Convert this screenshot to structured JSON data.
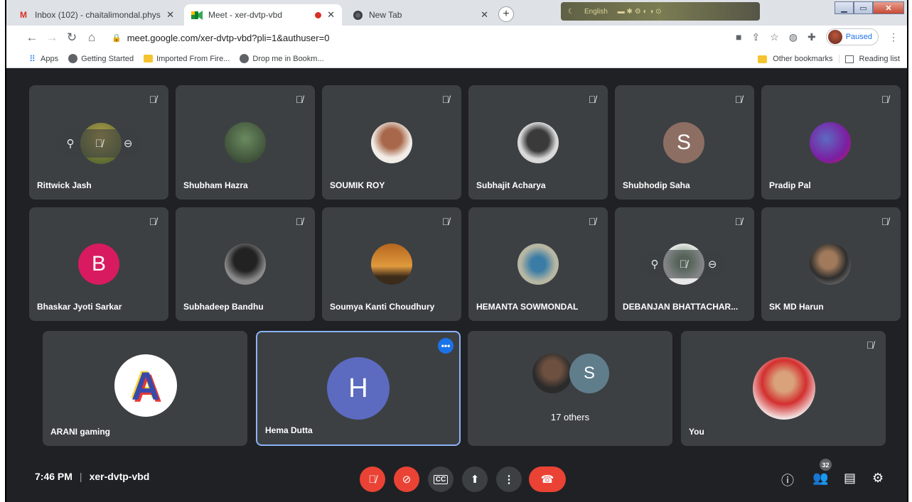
{
  "browser": {
    "tabs": [
      {
        "title": "Inbox (102) - chaitalimondal.phys",
        "favicon": "gmail-icon"
      },
      {
        "title": "Meet - xer-dvtp-vbd",
        "favicon": "meet-icon"
      },
      {
        "title": "New Tab",
        "favicon": "chrome-icon"
      }
    ],
    "taskbar_language": "English",
    "url": "meet.google.com/xer-dvtp-vbd?pli=1&authuser=0",
    "profile_status": "Paused",
    "bookmarks": [
      {
        "label": "Apps"
      },
      {
        "label": "Getting Started"
      },
      {
        "label": "Imported From Fire..."
      },
      {
        "label": "Drop me in Bookm..."
      }
    ],
    "other_bookmarks": "Other bookmarks",
    "reading_list": "Reading list"
  },
  "meet": {
    "time": "7:46 PM",
    "meeting_code": "xer-dvtp-vbd",
    "people_count": "32",
    "colors": {
      "accent_blue": "#1a73e8",
      "danger_red": "#ea4335",
      "tile_bg": "#3c4043",
      "stage_bg": "#202124"
    },
    "row1": [
      {
        "name": "Rittwick Jash",
        "avatar_color": "#6b7c3a",
        "initial": ""
      },
      {
        "name": "Shubham Hazra",
        "avatar_color": "#4f6b52",
        "initial": ""
      },
      {
        "name": "SOUMIK ROY",
        "avatar_color": "#c9b9a6",
        "initial": ""
      },
      {
        "name": "Subhajit Acharya",
        "avatar_color": "#d7d7d7",
        "initial": ""
      },
      {
        "name": "Shubhodip Saha",
        "avatar_color": "#8d6e63",
        "initial": "S"
      },
      {
        "name": "Pradip Pal",
        "avatar_color": "#7b1fa2",
        "initial": ""
      }
    ],
    "row2": [
      {
        "name": "Bhaskar Jyoti Sarkar",
        "avatar_color": "#d81b60",
        "initial": "B"
      },
      {
        "name": "Subhadeep Bandhu",
        "avatar_color": "#555555",
        "initial": ""
      },
      {
        "name": "Soumya Kanti Choudhury",
        "avatar_color": "#c17a2c",
        "initial": ""
      },
      {
        "name": "HEMANTA SOWMONDAL",
        "avatar_color": "#7a8a9a",
        "initial": ""
      },
      {
        "name": "DEBANJAN BHATTACHAR...",
        "avatar_color": "#dcdcdc",
        "initial": ""
      },
      {
        "name": "SK MD Harun",
        "avatar_color": "#6d6d6d",
        "initial": ""
      }
    ],
    "row3": [
      {
        "name": "ARANI gaming",
        "avatar_color": "#ffffff",
        "initial": "A"
      },
      {
        "name": "Hema Dutta",
        "avatar_color": "#5c6bc0",
        "initial": "H"
      },
      {
        "name": "17 others",
        "avatar_color": "#607d8b",
        "initial": "S"
      },
      {
        "name": "You",
        "avatar_color": "#e57373",
        "initial": ""
      }
    ]
  }
}
